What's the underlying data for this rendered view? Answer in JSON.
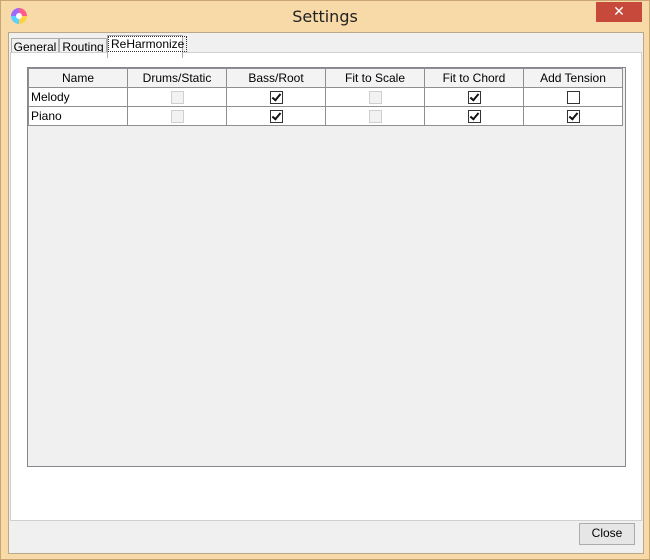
{
  "window": {
    "title": "Settings",
    "close_glyph": "✕"
  },
  "tabs": [
    {
      "label": "General",
      "active": false
    },
    {
      "label": "Routing",
      "active": false
    },
    {
      "label": "ReHarmonize",
      "active": true
    }
  ],
  "table": {
    "columns": [
      "Name",
      "Drums/Static",
      "Bass/Root",
      "Fit to Scale",
      "Fit to Chord",
      "Add Tension"
    ],
    "rows": [
      {
        "name": "Melody",
        "cells": [
          {
            "checked": false,
            "enabled": false
          },
          {
            "checked": true,
            "enabled": true
          },
          {
            "checked": false,
            "enabled": false
          },
          {
            "checked": true,
            "enabled": true
          },
          {
            "checked": false,
            "enabled": true
          }
        ]
      },
      {
        "name": "Piano",
        "cells": [
          {
            "checked": false,
            "enabled": false
          },
          {
            "checked": true,
            "enabled": true
          },
          {
            "checked": false,
            "enabled": false
          },
          {
            "checked": true,
            "enabled": true
          },
          {
            "checked": true,
            "enabled": true
          }
        ]
      }
    ]
  },
  "footer": {
    "close_label": "Close"
  }
}
